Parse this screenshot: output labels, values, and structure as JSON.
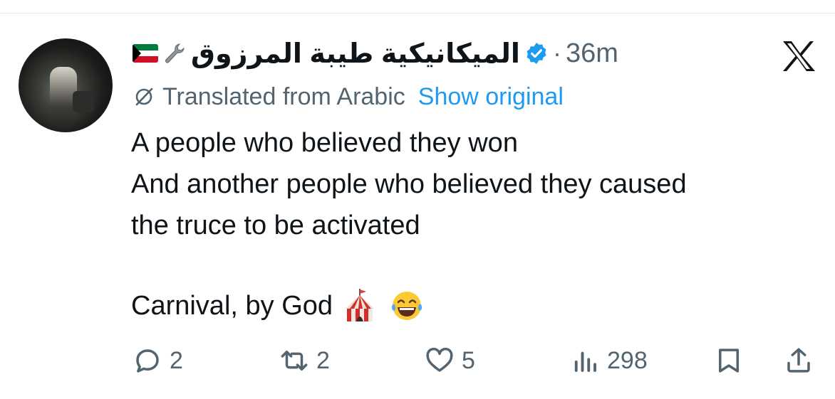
{
  "tweet": {
    "display_name": "الميكانيكية طيبة المرزوق",
    "time_separator": "·",
    "time": "36m",
    "translation_notice": "Translated from Arabic",
    "show_original": "Show original",
    "text_lines": [
      "A people who believed they won",
      "And another people who believed they caused",
      "the truce to be activated"
    ],
    "closing_line": "Carnival, by God"
  },
  "actions": {
    "replies": "2",
    "reposts": "2",
    "likes": "5",
    "views": "298"
  },
  "colors": {
    "accent": "#1d9bf0",
    "secondary_text": "#536471",
    "primary_text": "#0f1419"
  },
  "icons": [
    "kuwait-flag-icon",
    "wrench-icon",
    "verified-badge-icon",
    "x-logo-icon",
    "globe-slash-icon",
    "circus-tent-icon",
    "laughing-tears-icon",
    "reply-icon",
    "repost-icon",
    "like-icon",
    "views-icon",
    "bookmark-icon",
    "share-icon"
  ]
}
